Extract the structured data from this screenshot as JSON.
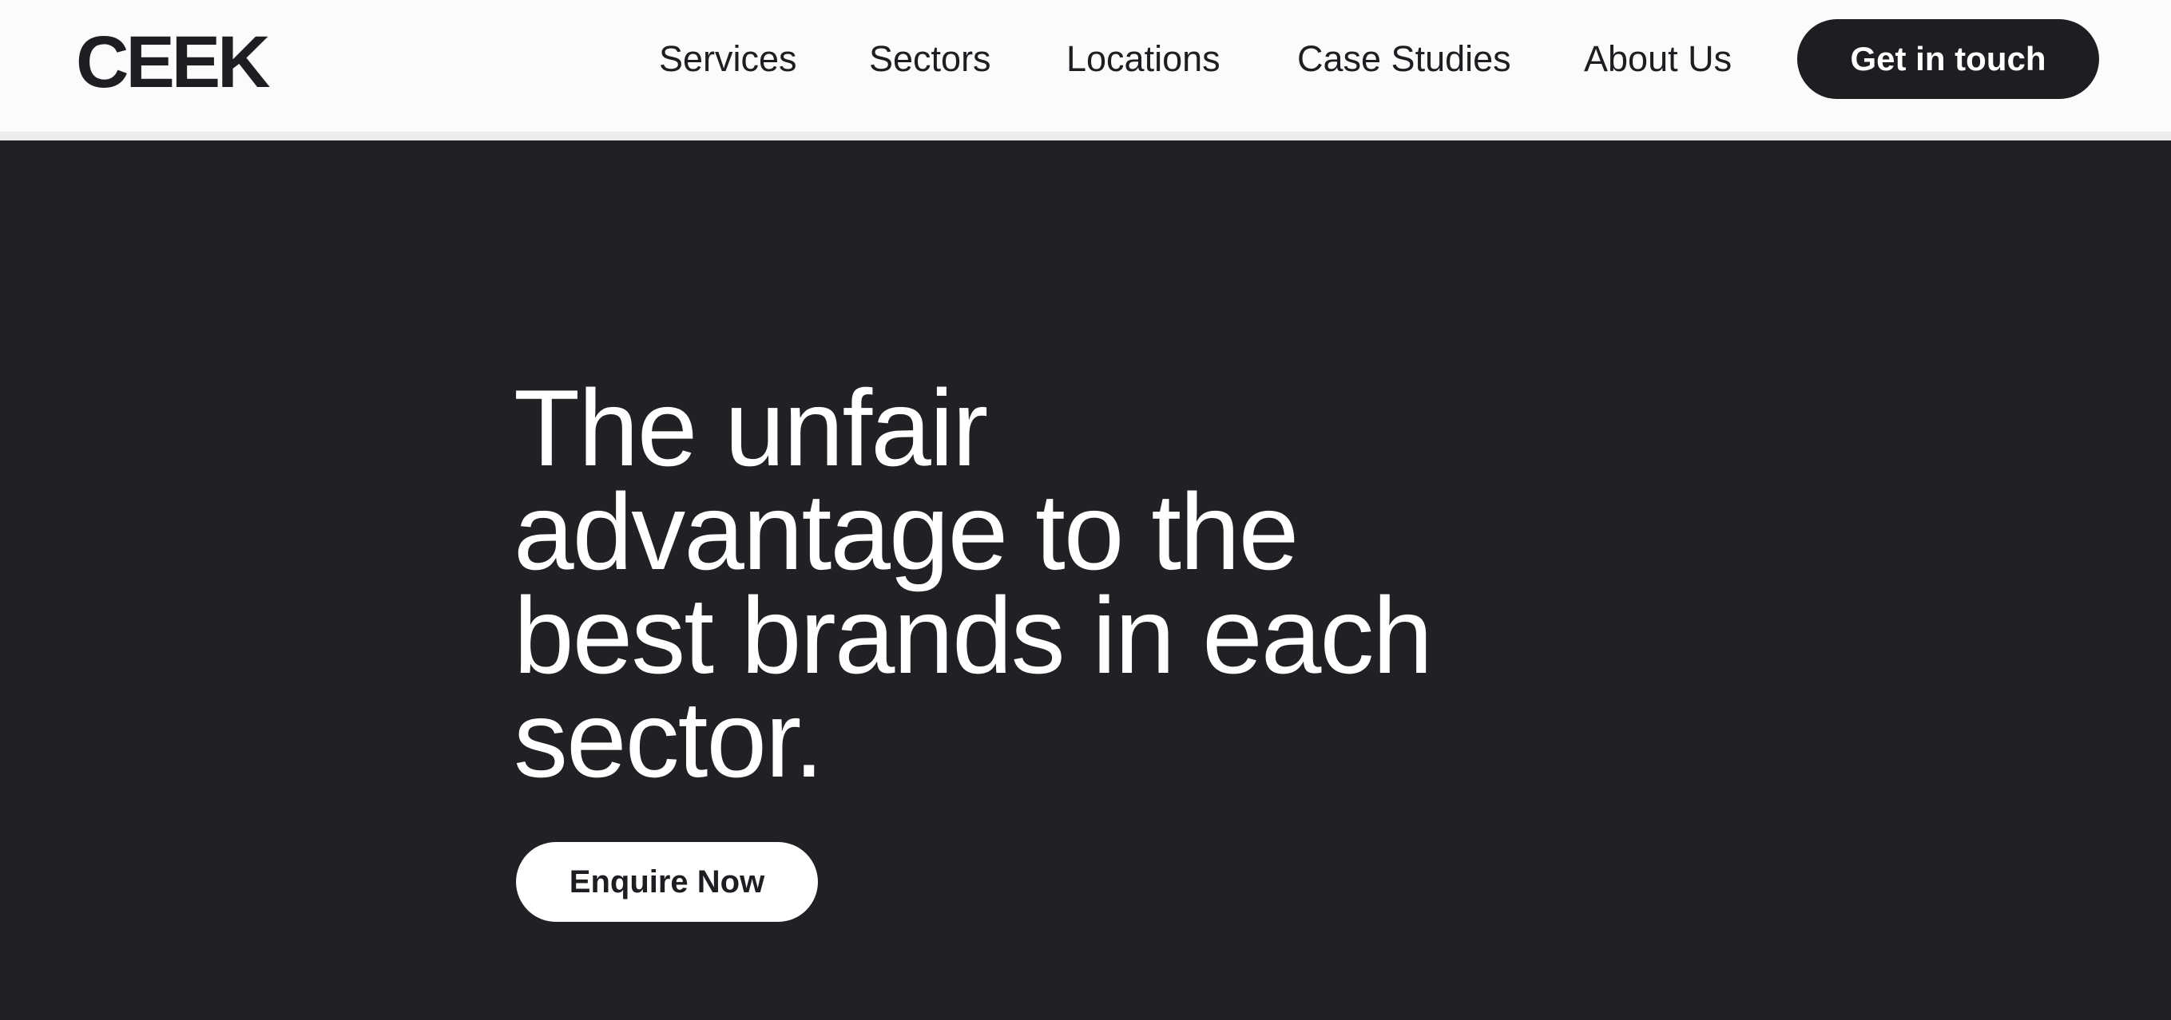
{
  "header": {
    "logo": "CEEK",
    "nav": {
      "services": "Services",
      "sectors": "Sectors",
      "locations": "Locations",
      "case_studies": "Case Studies",
      "about_us": "About Us"
    },
    "cta_label": "Get in touch"
  },
  "hero": {
    "headline_lines": [
      "The unfair",
      "advantage to the",
      "best brands in each",
      "sector."
    ],
    "button_label": "Enquire Now"
  },
  "colors": {
    "dark_background": "#222024",
    "header_background": "#fbfbfb",
    "text_dark": "#1f1d21",
    "text_light": "#ffffff"
  }
}
